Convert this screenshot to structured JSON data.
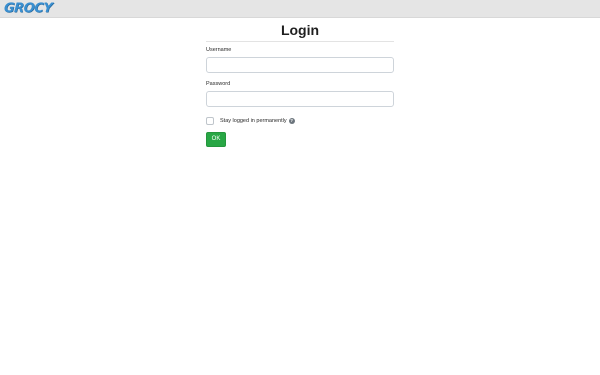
{
  "header": {
    "logo_text": "GROCY"
  },
  "login": {
    "title": "Login",
    "username_label": "Username",
    "username_value": "",
    "password_label": "Password",
    "password_value": "",
    "remember_label": "Stay logged in permanently",
    "remember_checked": false,
    "help_icon": "?",
    "submit_label": "OK"
  },
  "colors": {
    "topbar": "#e5e5e5",
    "logo": "#3a8fd0",
    "submit_button": "#28a745"
  }
}
